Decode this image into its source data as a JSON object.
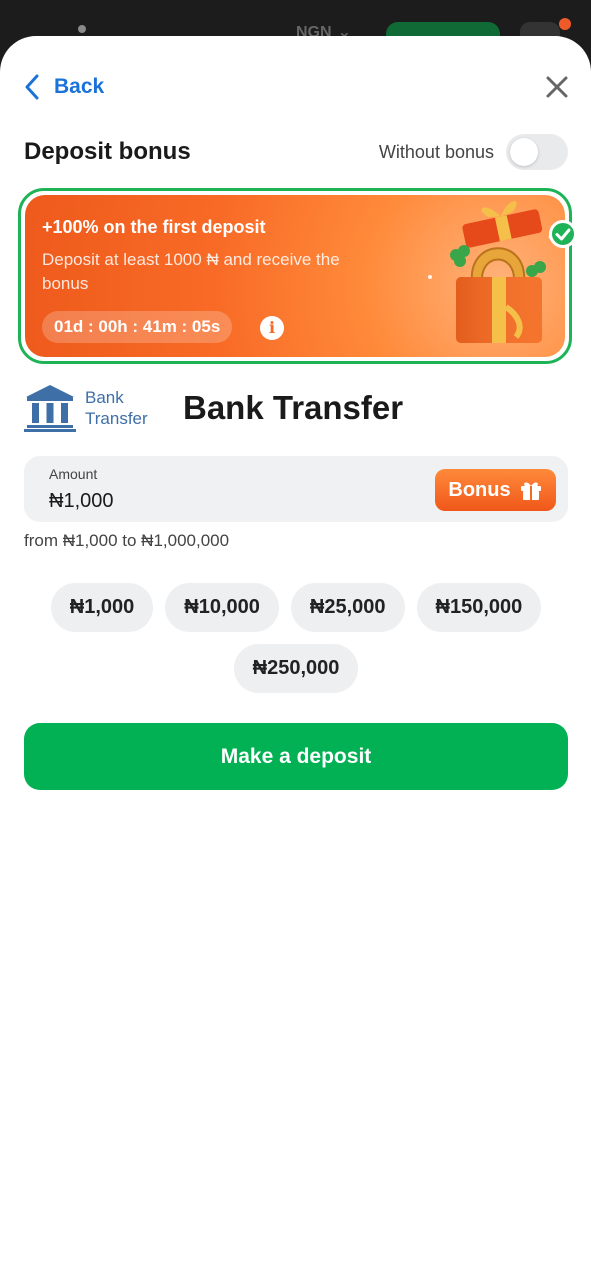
{
  "background": {
    "currency": "NGN"
  },
  "header": {
    "back_label": "Back"
  },
  "bonus": {
    "title": "Deposit bonus",
    "without_label": "Without bonus",
    "without_enabled": false
  },
  "promo": {
    "title": "+100% on the first deposit",
    "description": "Deposit at least 1000 ₦ and receive the bonus",
    "timer": "01d : 00h : 41m : 05s",
    "selected": true
  },
  "method": {
    "logo_line1": "Bank",
    "logo_line2": "Transfer",
    "title": "Bank Transfer"
  },
  "amount": {
    "label": "Amount",
    "value": "₦1,000",
    "bonus_button": "Bonus",
    "range": "from ₦1,000 to ₦1,000,000"
  },
  "chips": [
    "₦1,000",
    "₦10,000",
    "₦25,000",
    "₦150,000",
    "₦250,000"
  ],
  "deposit_button": "Make a deposit",
  "colors": {
    "accent_blue": "#1a73d9",
    "green": "#02b153",
    "orange": "#f05a1c"
  }
}
